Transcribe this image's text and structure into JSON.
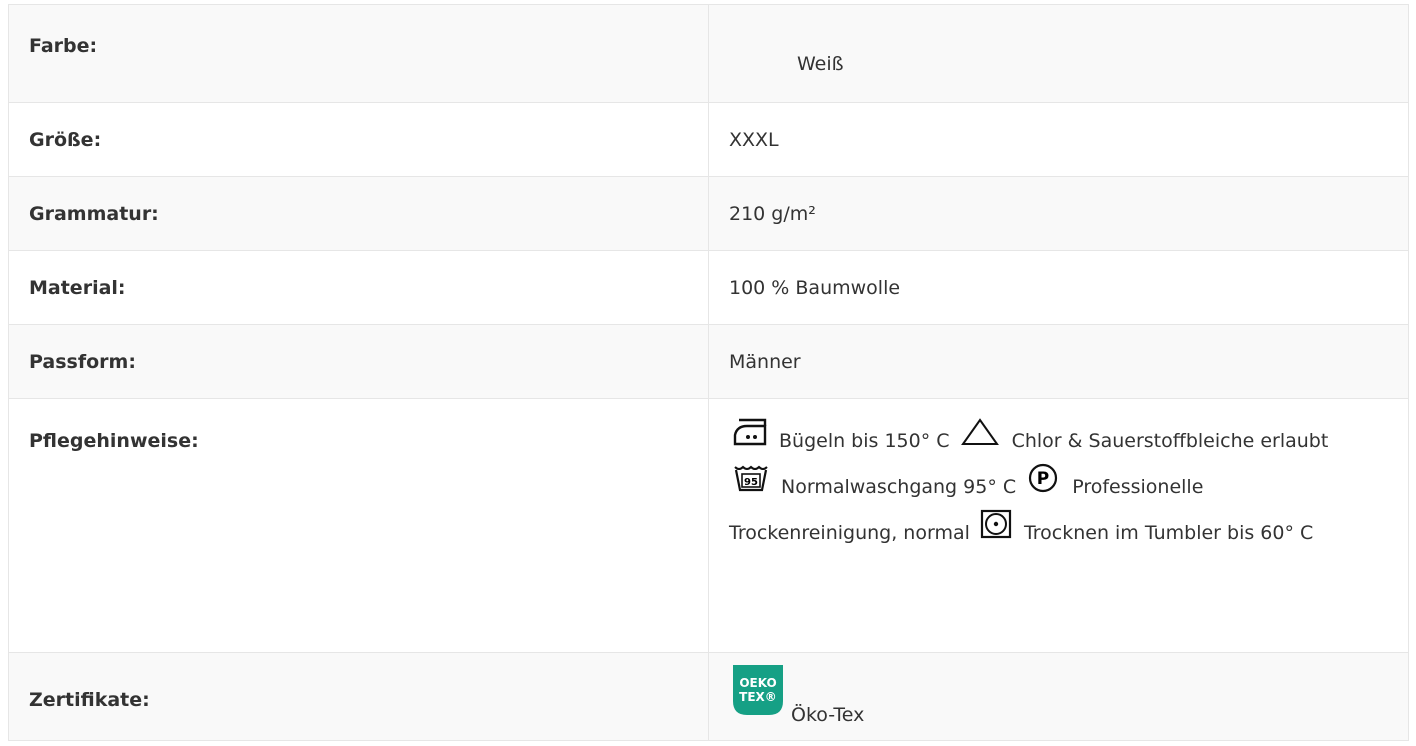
{
  "specs": {
    "farbe": {
      "label": "Farbe:",
      "value": "Weiß"
    },
    "groesse": {
      "label": "Größe:",
      "value": "XXXL"
    },
    "grammatur": {
      "label": "Grammatur:",
      "value": "210 g/m²"
    },
    "material": {
      "label": "Material:",
      "value": "100 % Baumwolle"
    },
    "passform": {
      "label": "Passform:",
      "value": "Männer"
    },
    "pflege": {
      "label": "Pflegehinweise:",
      "items": [
        {
          "icon": "iron-icon",
          "text": "Bügeln bis 150° C"
        },
        {
          "icon": "bleach-triangle-icon",
          "text": "Chlor & Sauerstoffbleiche erlaubt"
        },
        {
          "icon": "wash-tub-95-icon",
          "icon_text": "95",
          "text": "Normalwaschgang 95° C"
        },
        {
          "icon": "professional-cleaning-p-icon",
          "icon_text": "P",
          "text": "Professionelle Trockenreinigung, normal"
        },
        {
          "icon": "tumble-dry-icon",
          "text": "Trocknen im Tumbler bis 60° C"
        }
      ]
    },
    "zertifikate": {
      "label": "Zertifikate:",
      "logo_line1": "OEKO",
      "logo_line2": "TEX®",
      "value": "Öko-Tex"
    }
  },
  "colors": {
    "oeko_green": "#16a085",
    "border": "#e6e6e6",
    "stripe": "#f9f9f9"
  }
}
